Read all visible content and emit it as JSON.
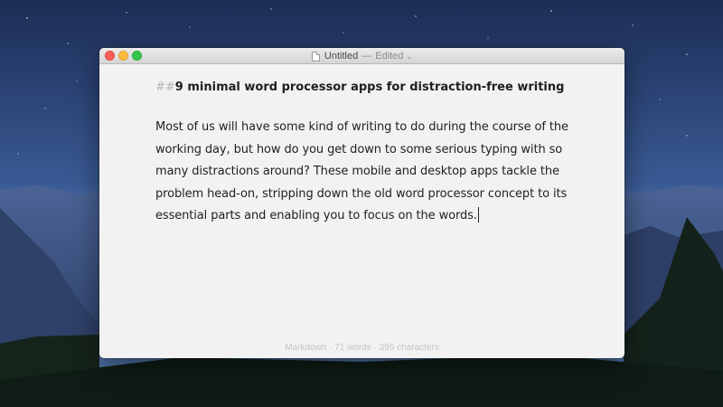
{
  "window": {
    "title": "Untitled",
    "separator": "—",
    "state": "Edited",
    "chevron": "⌄"
  },
  "document": {
    "heading_marker": "##",
    "heading_text": "9 minimal word processor apps for distraction-free writing",
    "body": "Most of us will have some kind of writing to do during the course of the working day, but how do you get down to some serious typing with so many distractions around? These mobile and desktop apps tackle the problem head-on, stripping down the old word processor concept to its essential parts and enabling you to focus on the words."
  },
  "status": {
    "text": "Markdown · 71 words · 395 characters"
  },
  "icons": {
    "close": "close-button-icon",
    "minimize": "minimize-button-icon",
    "zoom": "zoom-button-icon",
    "document": "document-icon"
  },
  "colors": {
    "close": "#fc605c",
    "minimize": "#fdbc40",
    "zoom": "#34c84a",
    "editor_bg": "#f2f2f2"
  }
}
